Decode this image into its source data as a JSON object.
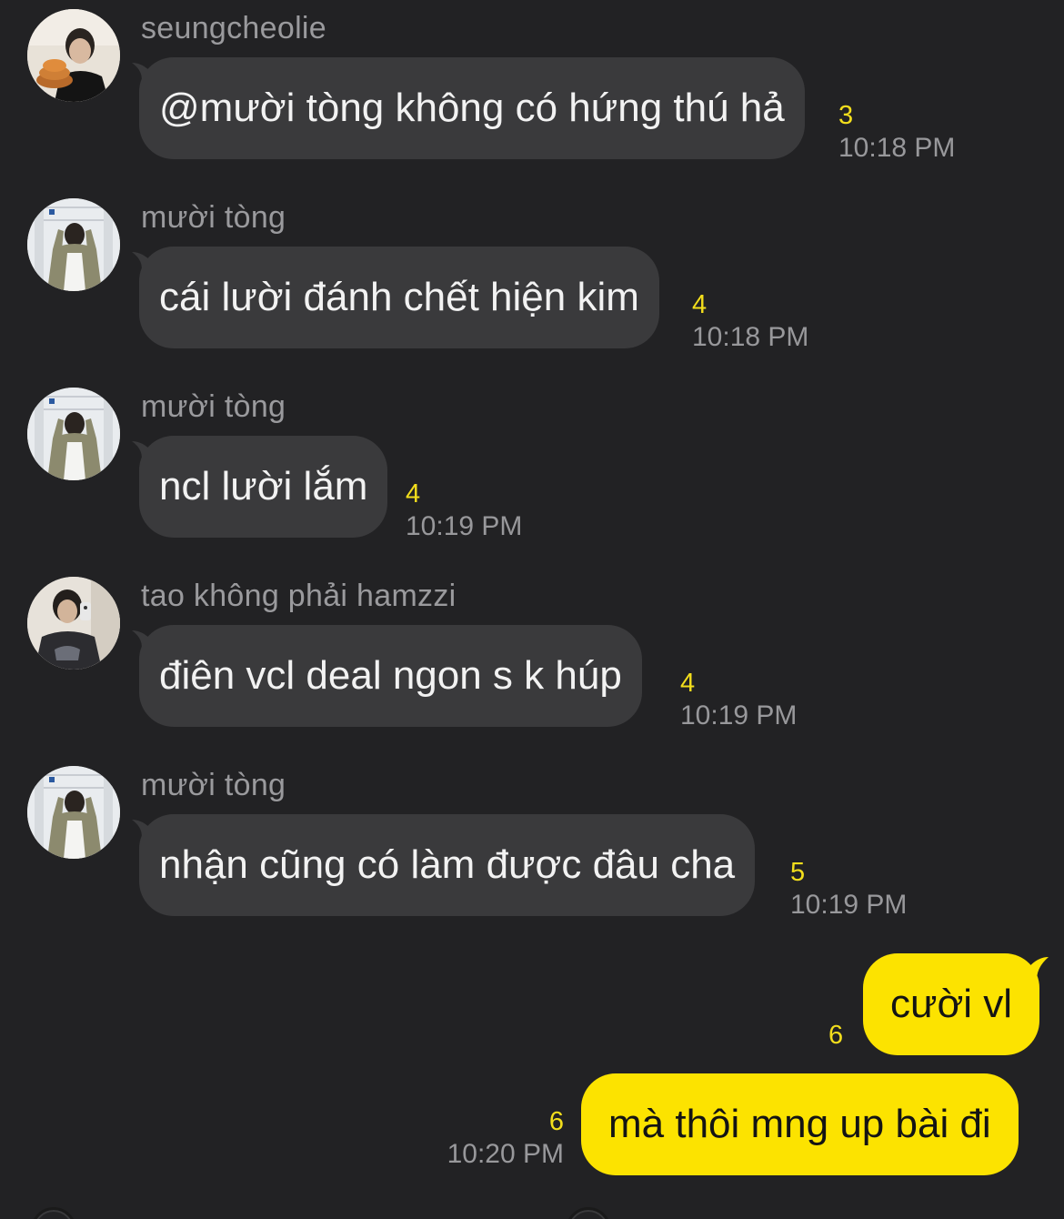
{
  "messages": [
    {
      "sender": "seungcheolie",
      "text": "@mười tòng không có hứng thú hả",
      "count": "3",
      "time": "10:18 PM",
      "avatar": "avatar-seungcheolie"
    },
    {
      "sender": "mười tòng",
      "text": "cái lười đánh chết hiện kim",
      "count": "4",
      "time": "10:18 PM",
      "avatar": "avatar-muoi-tong"
    },
    {
      "sender": "mười tòng",
      "text": "ncl lười lắm",
      "count": "4",
      "time": "10:19 PM",
      "avatar": "avatar-muoi-tong"
    },
    {
      "sender": "tao không phải hamzzi",
      "text": "điên vcl deal ngon s k húp",
      "count": "4",
      "time": "10:19 PM",
      "avatar": "avatar-hamzzi"
    },
    {
      "sender": "mười tòng",
      "text": "nhận cũng có làm được đâu cha",
      "count": "5",
      "time": "10:19 PM",
      "avatar": "avatar-muoi-tong"
    }
  ],
  "my_messages": [
    {
      "text": "cười vl",
      "count": "6",
      "time": ""
    },
    {
      "text": "mà thôi mng up bài đi",
      "count": "6",
      "time": "10:20 PM"
    }
  ],
  "colors": {
    "background": "#222224",
    "incoming_bubble": "#3a3a3c",
    "outgoing_bubble": "#fce300",
    "unread_count": "#f3de1c",
    "timestamp": "#98989b"
  }
}
